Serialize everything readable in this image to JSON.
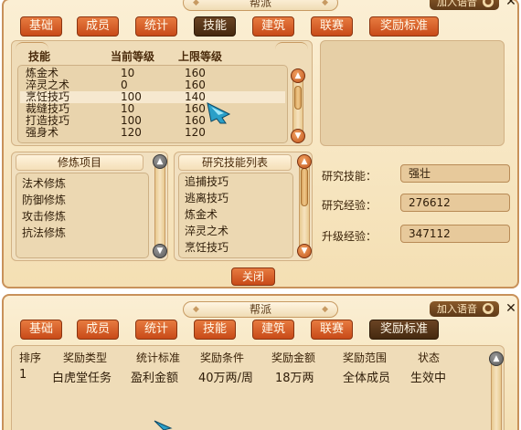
{
  "top_window": {
    "title": "帮派",
    "voice_button": "加入语音",
    "close_glyph": "✕",
    "tabs": [
      "基础",
      "成员",
      "统计",
      "技能",
      "建筑",
      "联赛",
      "奖励标准"
    ],
    "active_tab": "技能",
    "skill_table": {
      "headers": [
        "技能",
        "当前等级",
        "上限等级"
      ],
      "rows": [
        {
          "name": "炼金术",
          "current": "10",
          "max": "160"
        },
        {
          "name": "淬灵之术",
          "current": "0",
          "max": "160"
        },
        {
          "name": "烹饪技巧",
          "current": "100",
          "max": "140"
        },
        {
          "name": "裁缝技巧",
          "current": "10",
          "max": "160"
        },
        {
          "name": "打造技巧",
          "current": "100",
          "max": "160"
        },
        {
          "name": "强身术",
          "current": "120",
          "max": "120"
        }
      ]
    },
    "cultivation": {
      "header": "修炼项目",
      "items": [
        "法术修炼",
        "防御修炼",
        "攻击修炼",
        "抗法修炼"
      ]
    },
    "research_list": {
      "header": "研究技能列表",
      "items": [
        "追捕技巧",
        "逃离技巧",
        "炼金术",
        "淬灵之术",
        "烹饪技巧"
      ]
    },
    "research_info": {
      "skill_label": "研究技能：",
      "skill_value": "强壮",
      "exp_label": "研究经验：",
      "exp_value": "276612",
      "upgrade_label": "升级经验：",
      "upgrade_value": "347112"
    },
    "close_button": "关闭"
  },
  "bottom_window": {
    "title": "帮派",
    "voice_button": "加入语音",
    "close_glyph": "✕",
    "tabs": [
      "基础",
      "成员",
      "统计",
      "技能",
      "建筑",
      "联赛",
      "奖励标准"
    ],
    "active_tab": "奖励标准",
    "reward_table": {
      "headers": [
        "排序",
        "奖励类型",
        "统计标准",
        "奖励条件",
        "奖励金额",
        "奖励范围",
        "状态"
      ],
      "rows": [
        {
          "rank": "1",
          "type": "白虎堂任务",
          "standard": "盈利金额",
          "condition": "40万两/周",
          "amount": "18万两",
          "scope": "全体成员",
          "status": "生效中"
        }
      ]
    }
  }
}
